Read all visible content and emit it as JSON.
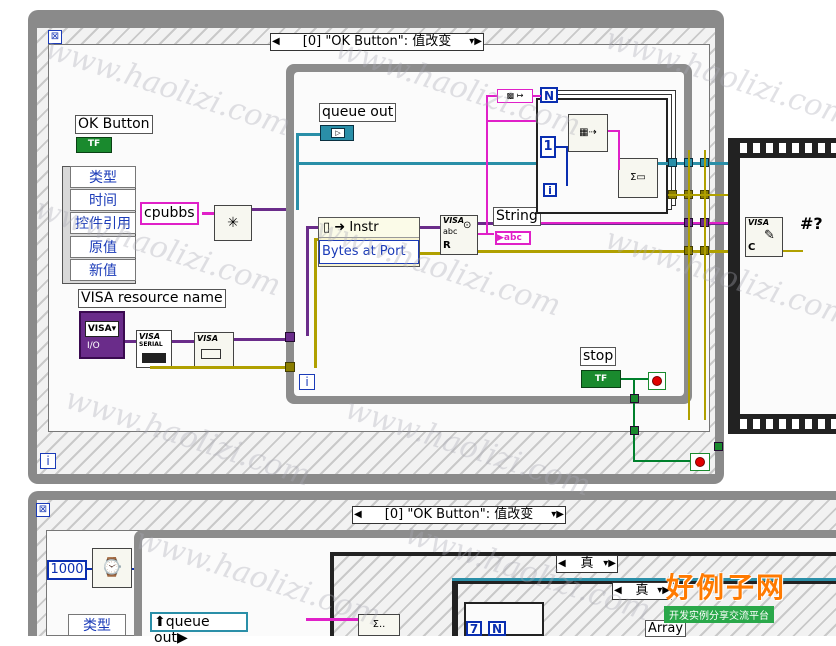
{
  "top_diagram": {
    "selector_label": "[0] \"OK Button\": 值改变",
    "event_data_items": [
      "类型",
      "时间",
      "控件引用",
      "原值",
      "新值"
    ],
    "ok_button_label": "OK Button",
    "ok_button_tf": "TF",
    "cpubbs_label": "cpubbs",
    "queue_out_label": "queue out",
    "visa_resource_label": "VISA resource name",
    "visa_ctrl_text": "VISA",
    "visa_io_text": "I/O",
    "visa_serial_line1": "VISA",
    "visa_serial_line2": "SERIAL",
    "visa_close_text": "VISA",
    "property_node_text": "Instr",
    "property_bytes": "Bytes at Port",
    "n_label": "N",
    "const_one": "1",
    "i_label": "i",
    "string_label": "String",
    "abc_label": "abc",
    "stop_label": "stop",
    "stop_tf": "TF",
    "visa_read_text": "VISA",
    "visa_read_r": "R",
    "visa_write_text": "VISA",
    "visa_write_c": "C",
    "loop_i": "i",
    "event_i": "i"
  },
  "bottom_diagram": {
    "selector_label": "[0] \"OK Button\": 值改变",
    "timeout_value": "1000",
    "event_item": "类型",
    "queue_out_label": "queue out",
    "true_case_outer": "真",
    "true_case_inner": "真",
    "n_label": "N",
    "n_const": "7",
    "array_label": "Array"
  },
  "watermark": {
    "text": "www.haolizi.com",
    "brand_cn": "好例子网",
    "brand_sub": "开发实例分享交流平台"
  }
}
